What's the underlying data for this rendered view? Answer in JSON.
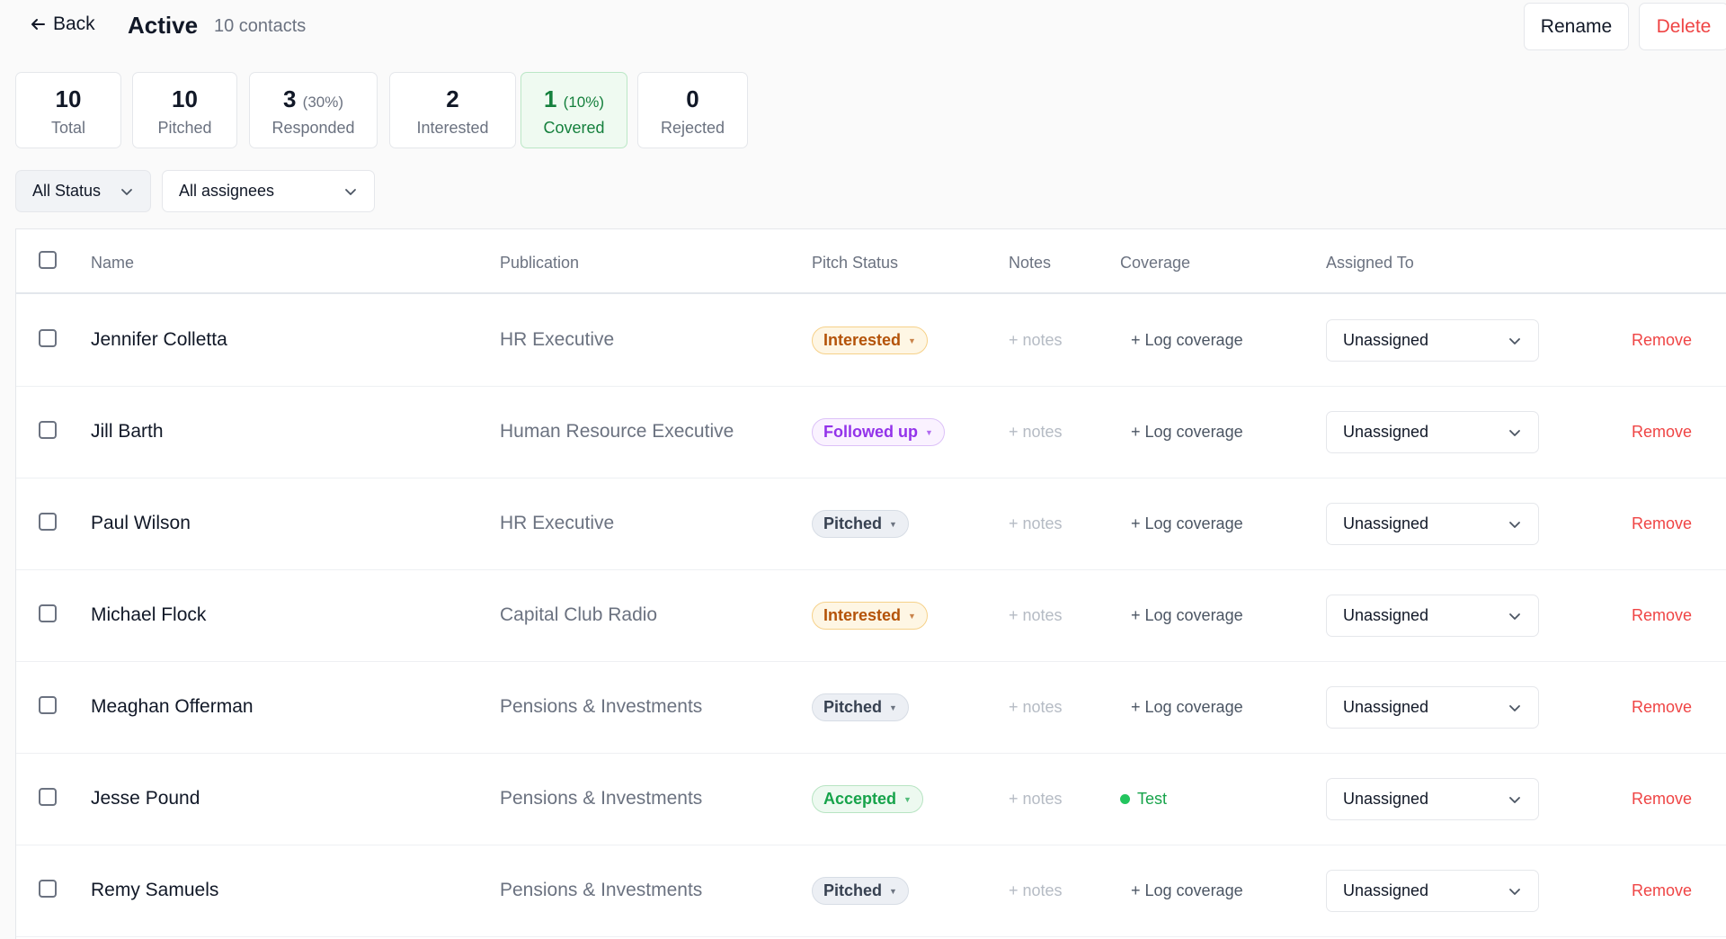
{
  "header": {
    "back_label": "Back",
    "title": "Active",
    "subtitle": "10 contacts",
    "rename_label": "Rename",
    "delete_label": "Delete"
  },
  "stats": [
    {
      "value": "10",
      "pct": "",
      "label": "Total"
    },
    {
      "value": "10",
      "pct": "",
      "label": "Pitched"
    },
    {
      "value": "3",
      "pct": "(30%)",
      "label": "Responded"
    },
    {
      "value": "2",
      "pct": "",
      "label": "Interested"
    },
    {
      "value": "1",
      "pct": "(10%)",
      "label": "Covered"
    },
    {
      "value": "0",
      "pct": "",
      "label": "Rejected"
    }
  ],
  "filters": {
    "status": "All Status",
    "assignee": "All assignees"
  },
  "table": {
    "columns": [
      "Name",
      "Publication",
      "Pitch Status",
      "Notes",
      "Coverage",
      "Assigned To"
    ],
    "rows": [
      {
        "name": "Jennifer Colletta",
        "publication": "HR Executive",
        "status": "Interested",
        "notes": "+ notes",
        "coverage": "+ Log coverage",
        "assigned": "Unassigned",
        "action": "Remove"
      },
      {
        "name": "Jill Barth",
        "publication": "Human Resource Executive",
        "status": "Followed up",
        "notes": "+ notes",
        "coverage": "+ Log coverage",
        "assigned": "Unassigned",
        "action": "Remove"
      },
      {
        "name": "Paul Wilson",
        "publication": "HR Executive",
        "status": "Pitched",
        "notes": "+ notes",
        "coverage": "+ Log coverage",
        "assigned": "Unassigned",
        "action": "Remove"
      },
      {
        "name": "Michael Flock",
        "publication": "Capital Club Radio",
        "status": "Interested",
        "notes": "+ notes",
        "coverage": "+ Log coverage",
        "assigned": "Unassigned",
        "action": "Remove"
      },
      {
        "name": "Meaghan Offerman",
        "publication": "Pensions & Investments",
        "status": "Pitched",
        "notes": "+ notes",
        "coverage": "+ Log coverage",
        "assigned": "Unassigned",
        "action": "Remove"
      },
      {
        "name": "Jesse Pound",
        "publication": "Pensions & Investments",
        "status": "Accepted",
        "notes": "+ notes",
        "coverage": "Test",
        "assigned": "Unassigned",
        "action": "Remove"
      },
      {
        "name": "Remy Samuels",
        "publication": "Pensions & Investments",
        "status": "Pitched",
        "notes": "+ notes",
        "coverage": "+ Log coverage",
        "assigned": "Unassigned",
        "action": "Remove"
      }
    ]
  },
  "colors": {
    "accent_red": "#ef4444",
    "covered_green": "#15803d",
    "interested_amber": "#b45309",
    "followed_purple": "#9333ea",
    "accepted_green": "#16a34a"
  }
}
